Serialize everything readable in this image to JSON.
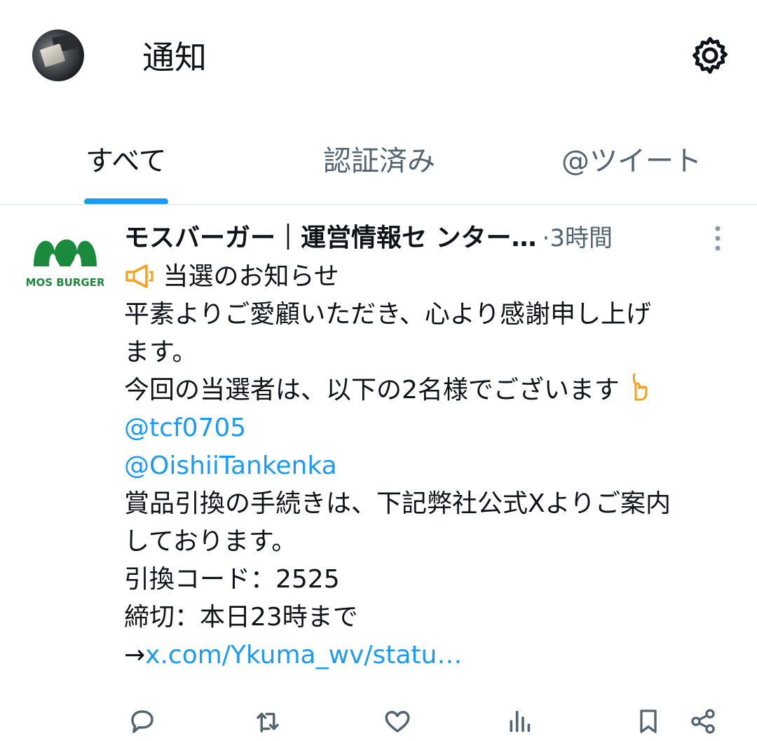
{
  "header": {
    "title": "通知"
  },
  "tabs": [
    {
      "label": "すべて",
      "active": true
    },
    {
      "label": "認証済み",
      "active": false
    },
    {
      "label": "@ツイート",
      "active": false
    }
  ],
  "colors": {
    "accent": "#1d9bf0",
    "secondary_text": "#536471",
    "mos_green": "#1c8a3c",
    "emoji_orange": "#f4a21d"
  },
  "tweet": {
    "logo_text": "MOS BURGER",
    "author": "モスバーガー｜運営情報セ ンター…",
    "separator": "·",
    "time": "3時間",
    "lines": {
      "l1": "当選のお知らせ",
      "l2": "平素よりご愛顧いただき、心より感謝申し上げ",
      "l3": "ます。",
      "l4": "今回の当選者は、以下の2名様でございます",
      "l5": "@tcf0705",
      "l6": "@OishiiTankenka",
      "l7": "賞品引換の手続きは、下記弊社公式Xよりご案内",
      "l8": "しております。",
      "l9": "引換コード：2525",
      "l10": "締切：本日23時まで",
      "l11_arrow": "→",
      "l11_link": "x.com/Ykuma_wv/statu…"
    }
  },
  "icons": {
    "settings": "gear-icon",
    "more": "more-vertical-icon",
    "megaphone": "megaphone-icon",
    "pointing": "pointing-down-hand-icon",
    "reply": "reply-icon",
    "retweet": "retweet-icon",
    "like": "heart-icon",
    "views": "bar-chart-icon",
    "bookmark": "bookmark-icon",
    "share": "share-icon"
  }
}
